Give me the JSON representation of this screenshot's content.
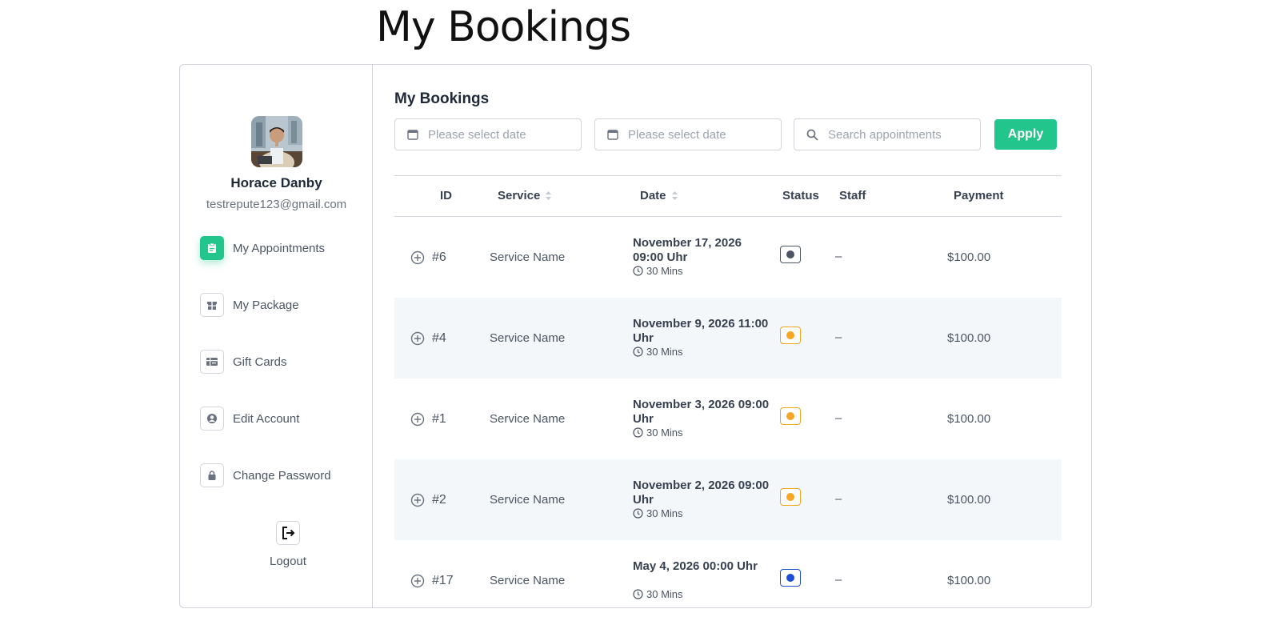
{
  "page": {
    "title": "My Bookings"
  },
  "user": {
    "name": "Horace Danby",
    "email": "testrepute123@gmail.com"
  },
  "nav": {
    "items": [
      {
        "label": "My Appointments",
        "icon": "clipboard-icon",
        "active": true
      },
      {
        "label": "My Package",
        "icon": "gift-icon",
        "active": false
      },
      {
        "label": "Gift Cards",
        "icon": "gift-card-icon",
        "active": false
      },
      {
        "label": "Edit Account",
        "icon": "user-circle-icon",
        "active": false
      },
      {
        "label": "Change Password",
        "icon": "lock-icon",
        "active": false
      }
    ],
    "logout": "Logout"
  },
  "main": {
    "title": "My Bookings",
    "filters": {
      "start_date_placeholder": "Please select date",
      "end_date_placeholder": "Please select date",
      "search_placeholder": "Search appointments",
      "apply_label": "Apply"
    },
    "table": {
      "headers": {
        "id": "ID",
        "service": "Service",
        "date": "Date",
        "status": "Status",
        "staff": "Staff",
        "payment": "Payment"
      },
      "rows": [
        {
          "id": "#6",
          "service": "Service Name",
          "date": "November 17, 2026 09:00 Uhr",
          "duration": "30 Mins",
          "status_color": "#4b5563",
          "staff": "–",
          "payment": "$100.00"
        },
        {
          "id": "#4",
          "service": "Service Name",
          "date": "November 9, 2026 11:00 Uhr",
          "duration": "30 Mins",
          "status_color": "#f5a623",
          "staff": "–",
          "payment": "$100.00"
        },
        {
          "id": "#1",
          "service": "Service Name",
          "date": "November 3, 2026 09:00 Uhr",
          "duration": "30 Mins",
          "status_color": "#f5a623",
          "staff": "–",
          "payment": "$100.00"
        },
        {
          "id": "#2",
          "service": "Service Name",
          "date": "November 2, 2026 09:00 Uhr",
          "duration": "30 Mins",
          "status_color": "#f5a623",
          "staff": "–",
          "payment": "$100.00"
        },
        {
          "id": "#17",
          "service": "Service Name",
          "date": "May 4, 2026 00:00 Uhr",
          "duration": "30 Mins",
          "status_color": "#1d4ed8",
          "staff": "–",
          "payment": "$100.00"
        }
      ]
    }
  },
  "colors": {
    "accent": "#22c58b",
    "border": "#d1d5db",
    "alt_row": "#f4f7f9"
  }
}
